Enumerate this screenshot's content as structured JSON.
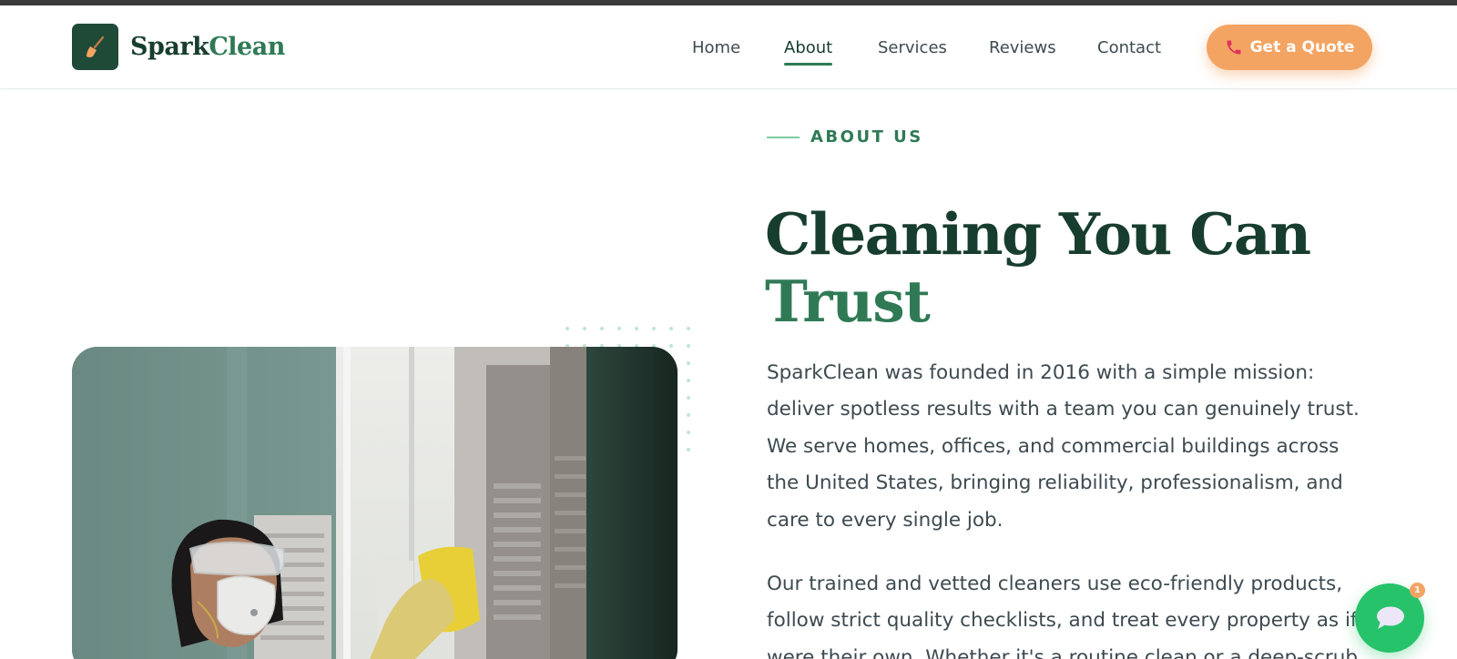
{
  "brand": {
    "name_part1": "Spark",
    "name_part2": "Clean",
    "logo_icon": "broom-icon"
  },
  "nav": {
    "items": [
      {
        "label": "Home",
        "active": false
      },
      {
        "label": "About",
        "active": true
      },
      {
        "label": "Services",
        "active": false
      },
      {
        "label": "Reviews",
        "active": false
      },
      {
        "label": "Contact",
        "active": false
      }
    ],
    "cta_label": "Get a Quote",
    "cta_icon": "phone-icon"
  },
  "about": {
    "eyebrow": "ABOUT US",
    "headline_line1": "Cleaning You Can",
    "headline_line2": "Trust",
    "paragraph1": "SparkClean was founded in 2016 with a simple mission: deliver spotless results with a team you can genuinely trust. We serve homes, offices, and commercial buildings across the United States, bringing reliability, professionalism, and care to every single job.",
    "paragraph2": "Our trained and vetted cleaners use eco-friendly products, follow strict quality checklists, and treat every property as if it were their own. Whether it's a routine clean or a deep-scrub"
  },
  "chat_widget": {
    "icon": "chat-bubble-icon",
    "badge_count": "1"
  },
  "colors": {
    "brand_dark": "#173d2e",
    "brand_green": "#2f7a55",
    "accent_orange": "#f3a462",
    "chat_green": "#27c36a",
    "text": "#3d4a50"
  }
}
